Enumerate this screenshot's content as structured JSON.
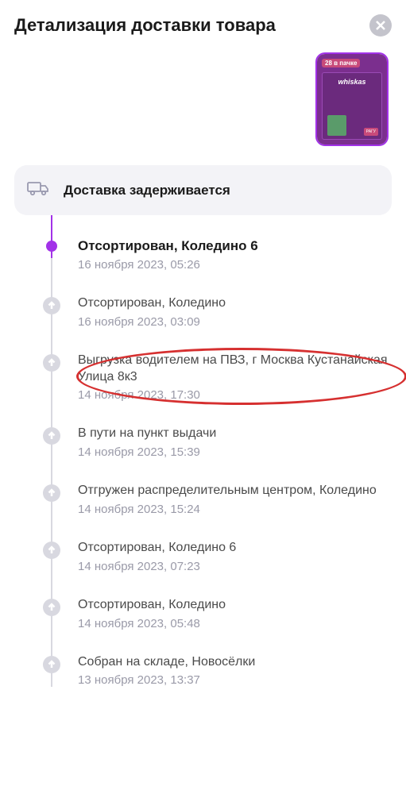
{
  "header": {
    "title": "Детализация доставки товара"
  },
  "product": {
    "badge": "28 в пачке",
    "logo": "whiskas",
    "label": "РАГУ"
  },
  "status": {
    "text": "Доставка задерживается"
  },
  "timeline": [
    {
      "status": "Отсортирован, Коледино 6",
      "date": "16 ноября 2023, 05:26",
      "current": true
    },
    {
      "status": "Отсортирован, Коледино",
      "date": "16 ноября 2023, 03:09"
    },
    {
      "status": "Выгрузка водителем на ПВЗ, г Москва Кустанайская Улица 8к3",
      "date": "14 ноября 2023, 17:30",
      "highlighted": true
    },
    {
      "status": "В пути на пункт выдачи",
      "date": "14 ноября 2023, 15:39"
    },
    {
      "status": "Отгружен распределительным центром, Коледино",
      "date": "14 ноября 2023, 15:24"
    },
    {
      "status": "Отсортирован, Коледино 6",
      "date": "14 ноября 2023, 07:23"
    },
    {
      "status": "Отсортирован, Коледино",
      "date": "14 ноября 2023, 05:48"
    },
    {
      "status": "Собран на складе, Новосёлки",
      "date": "13 ноября 2023, 13:37"
    }
  ]
}
